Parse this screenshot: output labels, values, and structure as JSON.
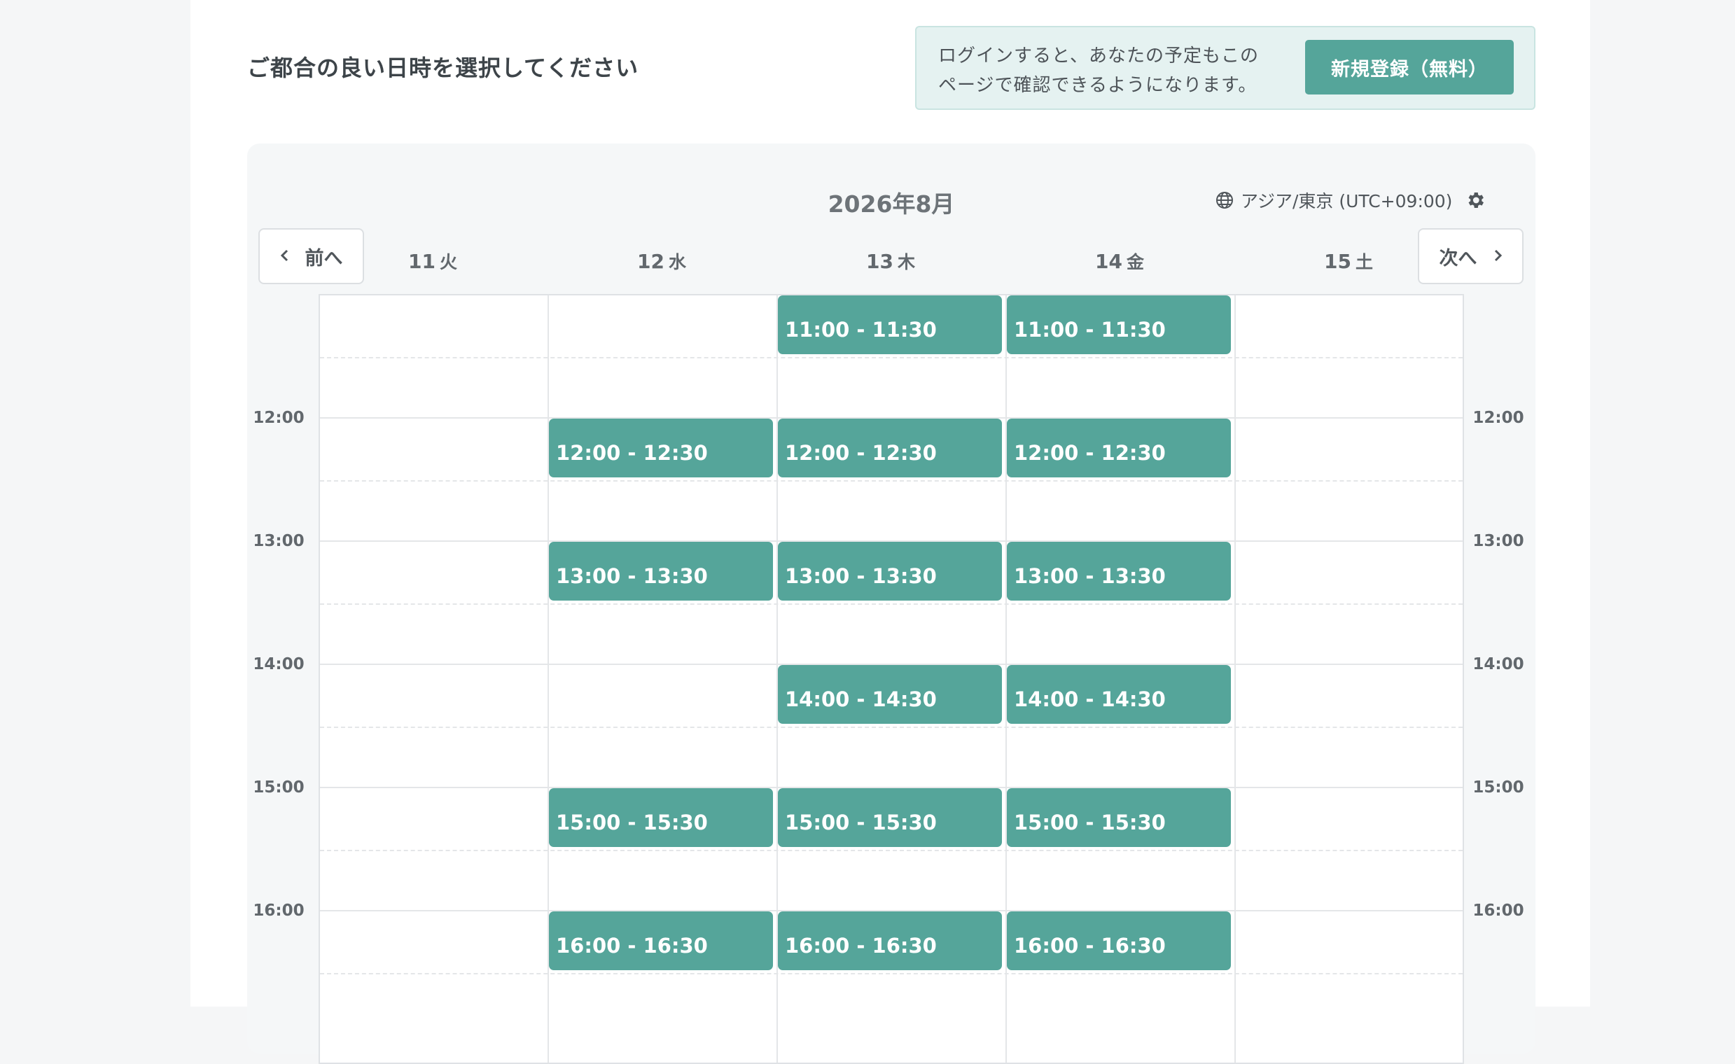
{
  "heading": "ご都合の良い日時を選択してください",
  "login_notice": {
    "text_line1": "ログインすると、あなたの予定もこの",
    "text_line2": "ページで確認できるようになります。",
    "signup_label": "新規登録（無料）"
  },
  "calendar": {
    "month_title": "2026年8月",
    "timezone": "アジア/東京 (UTC+09:00)",
    "prev_label": "前へ",
    "next_label": "次へ",
    "days": [
      {
        "date": "11",
        "dow": "火"
      },
      {
        "date": "12",
        "dow": "水"
      },
      {
        "date": "13",
        "dow": "木"
      },
      {
        "date": "14",
        "dow": "金"
      },
      {
        "date": "15",
        "dow": "土"
      }
    ],
    "hours": [
      "12:00",
      "13:00",
      "14:00",
      "15:00",
      "16:00"
    ],
    "slots": {
      "d13_1100": "11:00 - 11:30",
      "d14_1100": "11:00 - 11:30",
      "d12_1200": "12:00 - 12:30",
      "d13_1200": "12:00 - 12:30",
      "d14_1200": "12:00 - 12:30",
      "d12_1300": "13:00 - 13:30",
      "d13_1300": "13:00 - 13:30",
      "d14_1300": "13:00 - 13:30",
      "d13_1400": "14:00 - 14:30",
      "d14_1400": "14:00 - 14:30",
      "d12_1500": "15:00 - 15:30",
      "d13_1500": "15:00 - 15:30",
      "d14_1500": "15:00 - 15:30",
      "d12_1600": "16:00 - 16:30",
      "d13_1600": "16:00 - 16:30",
      "d14_1600": "16:00 - 16:30"
    }
  },
  "colors": {
    "accent": "#55a59a",
    "notice_bg": "#e5f2f1"
  },
  "icons": {
    "timezone": "globe-icon",
    "settings": "gear-icon",
    "prev": "chevron-left-icon",
    "next": "chevron-right-icon"
  }
}
